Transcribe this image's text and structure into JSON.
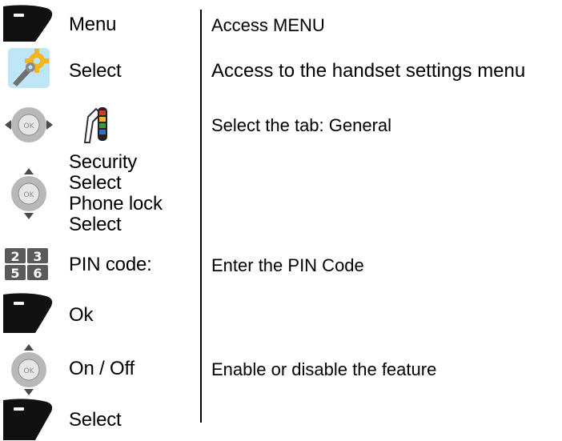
{
  "colors": {
    "softkey": "#111111",
    "nav_ring": "#b8b8b8",
    "nav_center": "#e6e6e6",
    "nav_arrow": "#4a4a4a",
    "numkey_bg": "#5a5a5a",
    "numkey_text": "#ffffff",
    "settings_icon_bg": "#bfe6f7",
    "settings_gear": "#f2b51d"
  },
  "icons": {
    "row1": "softkey-icon",
    "row2": "settings-icon",
    "row3_nav": "nav-left-right-icon",
    "row3_tab": "general-tab-icon",
    "row4": "nav-up-down-icon",
    "row5": "numeric-keypad-icon",
    "row6": "softkey-icon",
    "row7": "nav-up-down-icon",
    "row8": "softkey-icon"
  },
  "nav_key_center_text": "OK",
  "keypad_digits": [
    "2",
    "3",
    "5",
    "6"
  ],
  "steps": [
    {
      "action": "Menu",
      "description": "Access MENU"
    },
    {
      "action": "Select",
      "description": "Access to the handset settings menu"
    },
    {
      "action": "",
      "description": "Select the tab: General"
    },
    {
      "actions": [
        "Security",
        "Select",
        "Phone lock",
        "Select"
      ],
      "description": ""
    },
    {
      "action": "PIN code:",
      "description": "Enter the PIN Code"
    },
    {
      "action": "Ok",
      "description": ""
    },
    {
      "action": "On / Off",
      "description": "Enable or disable the feature"
    },
    {
      "action": "Select",
      "description": ""
    }
  ]
}
